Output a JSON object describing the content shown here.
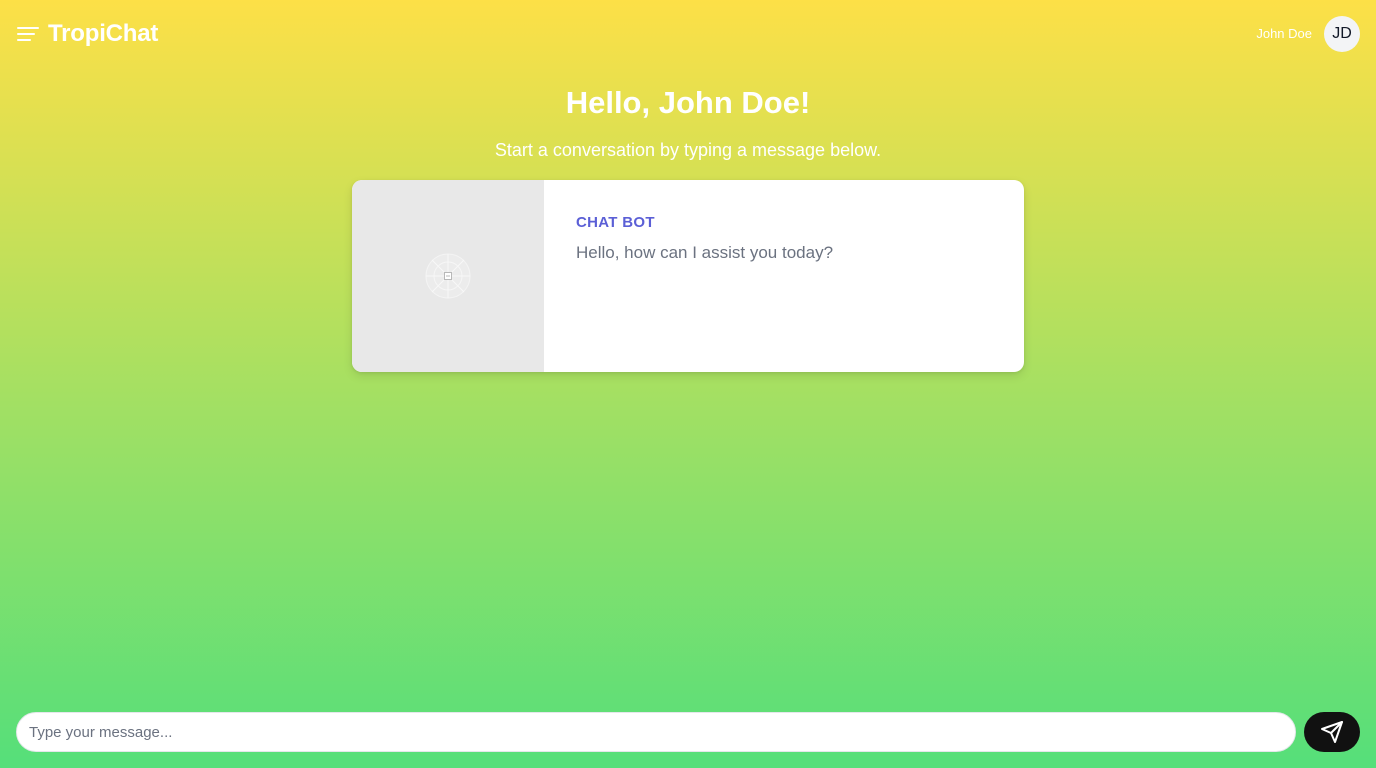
{
  "header": {
    "app_title": "TropiChat",
    "menu_icon": "hamburger-menu-icon",
    "user_name": "John Doe",
    "avatar_initials": "JD"
  },
  "main": {
    "greeting": "Hello, John Doe!",
    "subtitle": "Start a conversation by typing a message below."
  },
  "card": {
    "image_icon": "broken-image-icon",
    "label": "CHAT BOT",
    "message": "Hello, how can I assist you today?"
  },
  "composer": {
    "placeholder": "Type your message...",
    "value": "",
    "send_icon": "send-icon"
  },
  "colors": {
    "gradient_top": "#fde047",
    "gradient_bottom": "#55df7a",
    "accent": "#5b5fd6",
    "send_button": "#111111"
  }
}
